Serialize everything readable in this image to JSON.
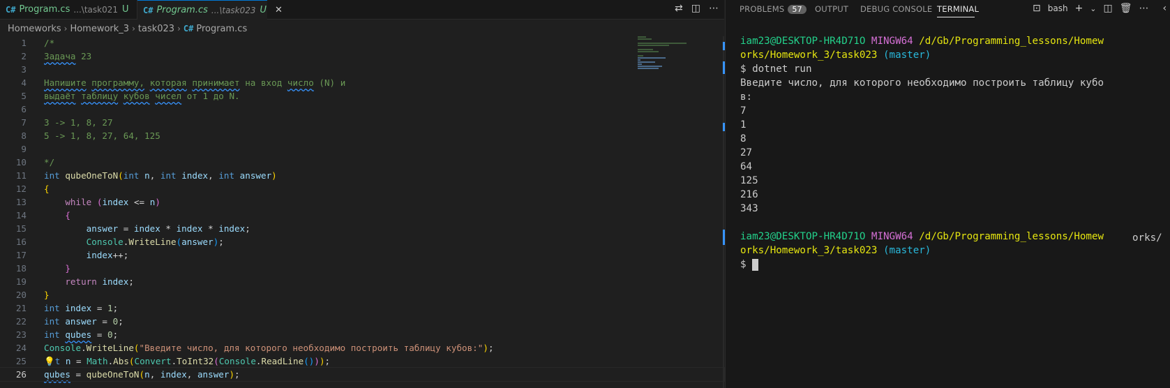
{
  "tabs": [
    {
      "icon": "C#",
      "name": "Program.cs",
      "path": "...\\task021",
      "status": "U"
    },
    {
      "icon": "C#",
      "name": "Program.cs",
      "path": "...\\task023",
      "status": "U",
      "close": "✕"
    }
  ],
  "breadcrumb": [
    "Homeworks",
    "Homework_3",
    "task023",
    "Program.cs"
  ],
  "breadcrumb_sep": "›",
  "editor": {
    "line_numbers": [
      "1",
      "2",
      "3",
      "4",
      "5",
      "6",
      "7",
      "8",
      "9",
      "10",
      "11",
      "12",
      "13",
      "14",
      "15",
      "16",
      "17",
      "18",
      "19",
      "20",
      "21",
      "22",
      "23",
      "24",
      "25",
      "26"
    ],
    "current_line": 26,
    "comment": {
      "open": "/*",
      "task_word": "Задача",
      "task_num": "23",
      "desc1": [
        "Напишите",
        "программу,",
        "которая",
        "принимает",
        "на вход",
        "число",
        "(N) и"
      ],
      "desc2": [
        "выдаёт",
        "таблицу",
        "кубов",
        "чисел",
        "от 1 до N."
      ],
      "ex1": "3 -> 1, 8, 27",
      "ex2": "5 -> 1, 8, 27, 64, 125",
      "close": "*/"
    },
    "tokens": {
      "int": "int",
      "while": "while",
      "return": "return",
      "fn": "qubeOneToN",
      "n": "n",
      "index": "index",
      "answer": "answer",
      "qubes": "qubes",
      "console": "Console",
      "writeline": "WriteLine",
      "math": "Math",
      "abs": "Abs",
      "convert": "Convert",
      "toint32": "ToInt32",
      "readline": "ReadLine",
      "zero": "0",
      "one": "1",
      "prompt_string": "\"Введите число, для которого необходимо построить таблицу кубов:\"",
      "squiggle_prompt": "необходимо построить таблицу кубов:",
      "lt": "it"
    }
  },
  "panel": {
    "tabs": {
      "problems": "PROBLEMS",
      "problems_count": "57",
      "output": "OUTPUT",
      "debug": "DEBUG CONSOLE",
      "terminal": "TERMINAL"
    },
    "shell_label": "bash"
  },
  "terminal": {
    "user": "iam23@DESKTOP-HR4D71O",
    "env": "MINGW64",
    "path1": "/d/Gb/Programming_lessons/Homew",
    "path2": "orks/Homework_3/task023",
    "branch": "(master)",
    "prompt": "$",
    "command": "dotnet run",
    "out1": "Введите число, для которого необходимо построить таблицу кубо",
    "out2": "в:",
    "values": [
      "7",
      "1",
      "8",
      "27",
      "64",
      "125",
      "216",
      "343"
    ],
    "overflow": "orks/"
  }
}
